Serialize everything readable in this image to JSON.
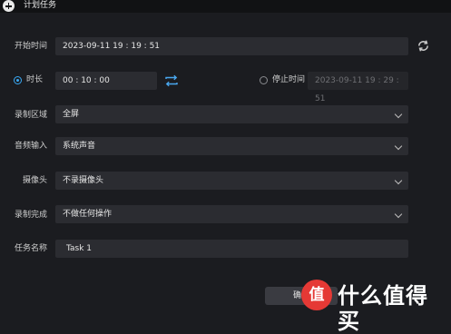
{
  "window": {
    "title": "计划任务",
    "add_icon": "plus-circle-icon"
  },
  "form": {
    "start_time": {
      "label": "开始时间",
      "value": "2023-09-11 19 : 19 : 51",
      "refresh_icon": "refresh-icon"
    },
    "duration": {
      "label": "时长",
      "value": "00 : 10 : 00",
      "selected": true,
      "swap_icon": "swap-icon"
    },
    "stop_time": {
      "label": "停止时间",
      "value": "2023-09-11 19 : 29 : 51",
      "selected": false
    },
    "record_area": {
      "label": "录制区域",
      "value": "全屏"
    },
    "audio_input": {
      "label": "音频输入",
      "value": "系统声音"
    },
    "camera": {
      "label": "摄像头",
      "value": "不录摄像头"
    },
    "on_complete": {
      "label": "录制完成",
      "value": "不做任何操作"
    },
    "task_name": {
      "label": "任务名称",
      "value": "Task 1"
    }
  },
  "footer": {
    "confirm_label": "确定"
  },
  "watermark": {
    "logo_text": "值",
    "text": "什么值得买"
  },
  "colors": {
    "accent": "#39a9f5",
    "field_bg": "#2b2c31",
    "background": "#1b1c20"
  }
}
